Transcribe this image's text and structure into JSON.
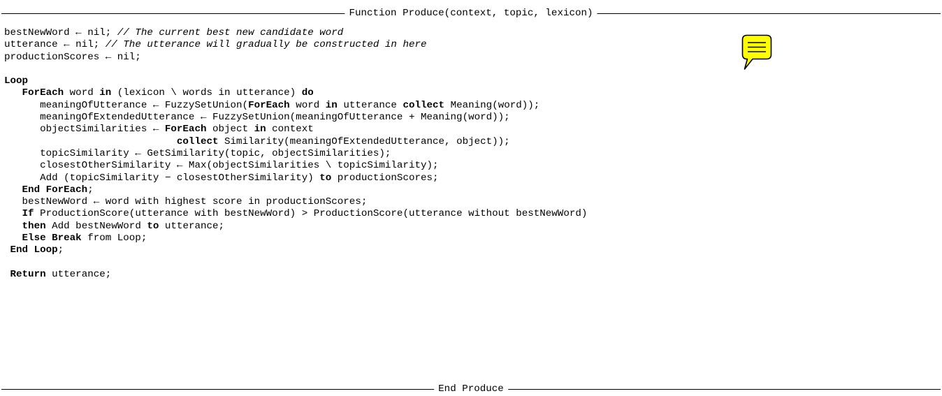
{
  "header": {
    "title": "Function Produce(context, topic, lexicon)"
  },
  "footer": {
    "title": "End Produce"
  },
  "colors": {
    "comment_icon_fill": "#ffff00",
    "comment_icon_stroke": "#000000"
  },
  "annotation": {
    "icon": "comment-icon"
  },
  "code": {
    "lines": [
      [
        {
          "t": "bestNewWord ← nil; "
        },
        {
          "t": "// The current best new candidate word",
          "s": "cm"
        }
      ],
      [
        {
          "t": "utterance ← nil; "
        },
        {
          "t": "// The utterance will gradually be constructed in here",
          "s": "cm"
        }
      ],
      [
        {
          "t": "productionScores ← nil;"
        }
      ],
      [],
      [
        {
          "t": "Loop",
          "s": "kw"
        }
      ],
      [
        {
          "t": "   "
        },
        {
          "t": "ForEach",
          "s": "kw"
        },
        {
          "t": " word "
        },
        {
          "t": "in",
          "s": "kw"
        },
        {
          "t": " (lexicon \\ words in utterance) "
        },
        {
          "t": "do",
          "s": "kw"
        }
      ],
      [
        {
          "t": "      meaningOfUtterance ← FuzzySetUnion("
        },
        {
          "t": "ForEach",
          "s": "kw"
        },
        {
          "t": " word "
        },
        {
          "t": "in",
          "s": "kw"
        },
        {
          "t": " utterance "
        },
        {
          "t": "collect",
          "s": "kw"
        },
        {
          "t": " Meaning(word));"
        }
      ],
      [
        {
          "t": "      meaningOfExtendedUtterance ← FuzzySetUnion(meaningOfUtterance + Meaning(word));"
        }
      ],
      [
        {
          "t": "      objectSimilarities ← "
        },
        {
          "t": "ForEach",
          "s": "kw"
        },
        {
          "t": " object "
        },
        {
          "t": "in",
          "s": "kw"
        },
        {
          "t": " context"
        }
      ],
      [
        {
          "t": "                             "
        },
        {
          "t": "collect",
          "s": "kw"
        },
        {
          "t": " Similarity(meaningOfExtendedUtterance, object));"
        }
      ],
      [
        {
          "t": "      topicSimilarity ← GetSimilarity(topic, objectSimilarities);"
        }
      ],
      [
        {
          "t": "      closestOtherSimilarity ← Max(objectSimilarities \\ topicSimilarity);"
        }
      ],
      [
        {
          "t": "      Add (topicSimilarity − closestOtherSimilarity) "
        },
        {
          "t": "to",
          "s": "kw"
        },
        {
          "t": " productionScores;"
        }
      ],
      [
        {
          "t": "   "
        },
        {
          "t": "End ForEach",
          "s": "kw"
        },
        {
          "t": ";"
        }
      ],
      [
        {
          "t": "   bestNewWord ← word with highest score in productionScores;"
        }
      ],
      [
        {
          "t": "   "
        },
        {
          "t": "If",
          "s": "kw"
        },
        {
          "t": " ProductionScore(utterance with bestNewWord) > ProductionScore(utterance without bestNewWord)"
        }
      ],
      [
        {
          "t": "   "
        },
        {
          "t": "then",
          "s": "kw"
        },
        {
          "t": " Add bestNewWord "
        },
        {
          "t": "to",
          "s": "kw"
        },
        {
          "t": " utterance;"
        }
      ],
      [
        {
          "t": "   "
        },
        {
          "t": "Else Break",
          "s": "kw"
        },
        {
          "t": " from Loop;"
        }
      ],
      [
        {
          "t": " "
        },
        {
          "t": "End Loop",
          "s": "kw"
        },
        {
          "t": ";"
        }
      ],
      [],
      [
        {
          "t": " "
        },
        {
          "t": "Return",
          "s": "kw"
        },
        {
          "t": " utterance;"
        }
      ]
    ]
  }
}
